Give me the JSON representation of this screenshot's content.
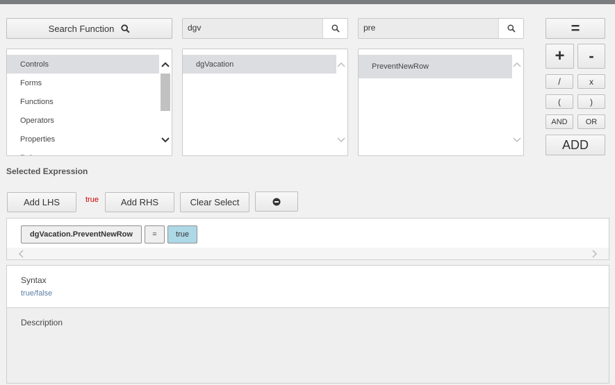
{
  "search_function": {
    "label": "Search Function",
    "icon": "search-icon"
  },
  "search1": {
    "value": "dgv",
    "icon": "search-icon"
  },
  "search2": {
    "value": "pre",
    "icon": "search-icon"
  },
  "categories": [
    "Controls",
    "Forms",
    "Functions",
    "Operators",
    "Properties",
    "Rules"
  ],
  "controls_list": [
    "dgVacation"
  ],
  "properties_list": [
    "PreventNewRow"
  ],
  "operators": {
    "equals": "=",
    "plus": "+",
    "minus": "-",
    "divide": "/",
    "multiply": "x",
    "open_paren": "(",
    "close_paren": ")",
    "and": "AND",
    "or": "OR",
    "add": "ADD"
  },
  "selected_expression_label": "Selected Expression",
  "buttons": {
    "add_lhs": "Add LHS",
    "add_rhs": "Add RHS",
    "clear_select": "Clear Select"
  },
  "lhs_value": "true",
  "expression": {
    "lhs": "dgVacation.PreventNewRow",
    "op": "=",
    "rhs": "true"
  },
  "syntax": {
    "title": "Syntax",
    "value": "true/false"
  },
  "description": {
    "title": "Description"
  },
  "colors": {
    "accent_rhs": "#add8e6",
    "syntax_value": "#5b7ea6",
    "true_red": "#cc0000"
  }
}
